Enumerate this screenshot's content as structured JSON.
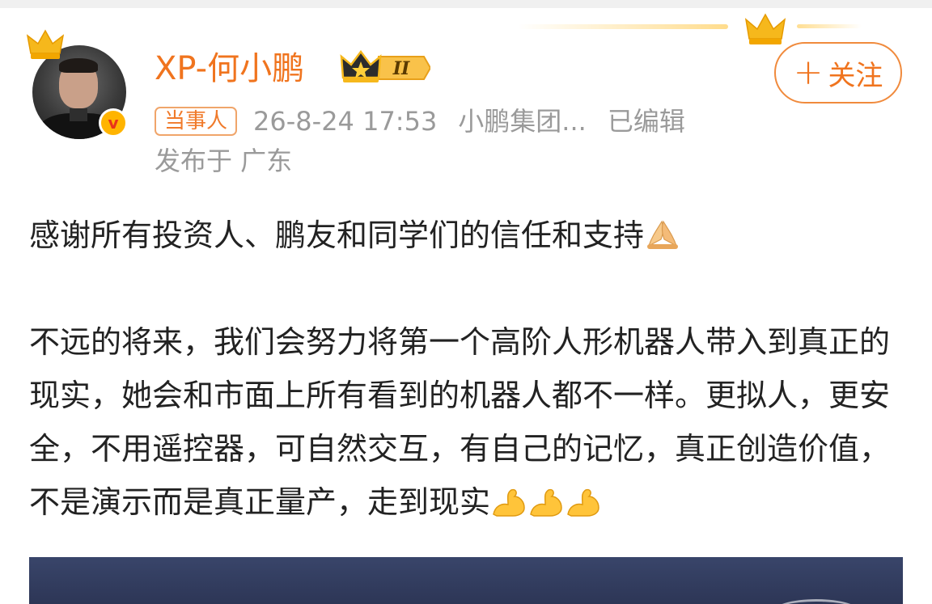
{
  "user": {
    "name": "XP-何小鹏",
    "level_numeral": "II",
    "verified_letter": "v"
  },
  "actions": {
    "follow_label": "关注",
    "follow_plus": "+"
  },
  "meta": {
    "tag": "当事人",
    "timestamp": "26-8-24 17:53",
    "source": "小鹏集团...",
    "edited": "已编辑",
    "location": "发布于 广东"
  },
  "post": {
    "paragraph1": "感谢所有投资人、鹏友和同学们的信任和支持",
    "paragraph2": "不远的将来，我们会努力将第一个高阶人形机器人带入到真正的现实，她会和市面上所有看到的机器人都不一样。更拟人，更安全，不用遥控器，可自然交互，有自己的记忆，真正创造价值，不是演示而是真正量产，走到现实"
  },
  "icons": {
    "crown": "crown-icon",
    "pray": "folded-hands-emoji",
    "muscle": "flexed-biceps-emoji",
    "verified": "verified-v-icon"
  },
  "colors": {
    "brand_orange": "#f0741e",
    "meta_gray": "#9a9a9a",
    "badge_gold": "#ffb400"
  }
}
